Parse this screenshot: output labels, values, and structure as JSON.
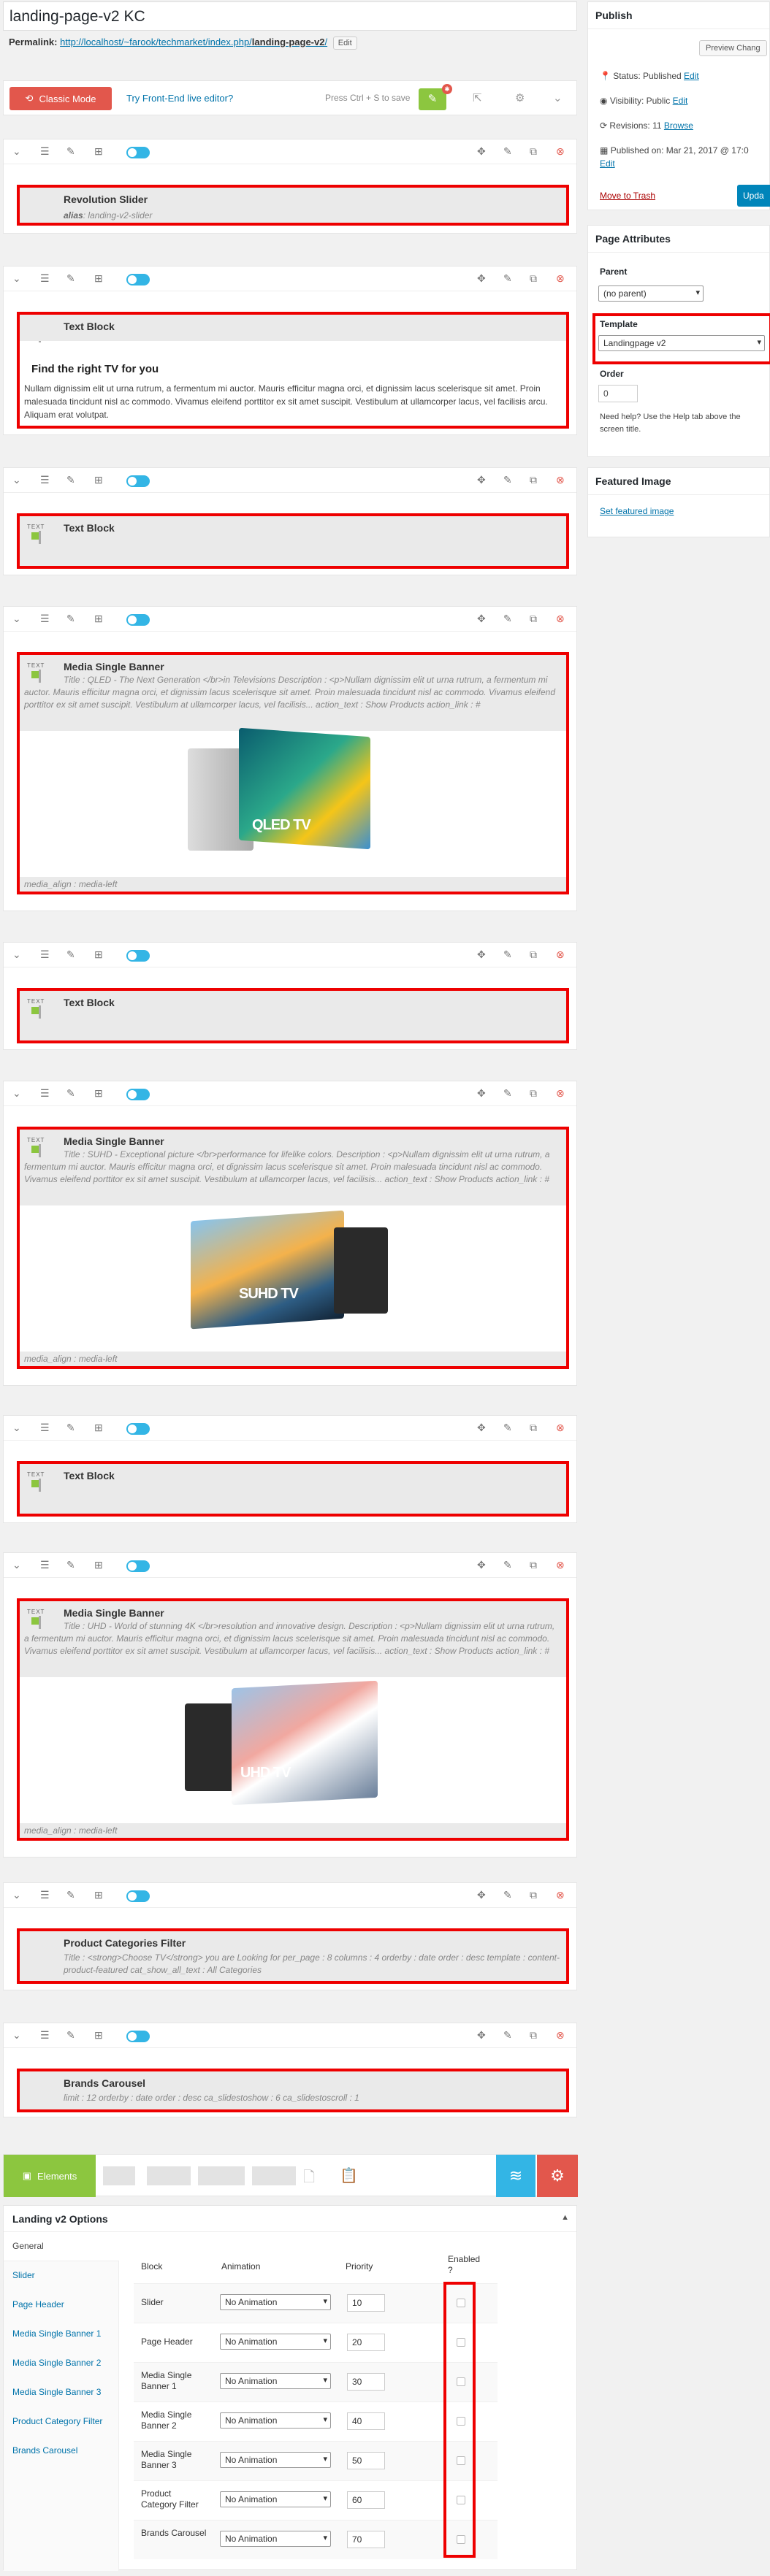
{
  "title": "landing-page-v2 KC",
  "permalink": {
    "label": "Permalink:",
    "url_base": "http://localhost/~farook/techmarket/index.php/",
    "slug": "landing-page-v2",
    "url_end": "/",
    "edit": "Edit"
  },
  "kc": {
    "classic": "Classic Mode",
    "try": "Try Front-End live editor?",
    "press": "Press Ctrl + S to save"
  },
  "rows": [
    {
      "title": "Revolution Slider",
      "sub_k": "alias",
      "sub_v": ": landing-v2-slider"
    },
    {
      "title": "Text Block",
      "heading": "Find the right TV for you",
      "para": "Nullam dignissim elit ut urna rutrum, a fermentum mi auctor. Mauris efficitur magna orci, et dignissim lacus scelerisque sit amet. Proin malesuada tincidunt nisl ac commodo. Vivamus eleifend porttitor ex sit amet suscipit. Vestibulum at ullamcorper lacus, vel facilisis arcu. Aliquam erat volutpat."
    },
    {
      "title": "Text Block"
    },
    {
      "title": "Media Single Banner",
      "desc": "Title : QLED - The Next Generation </br>in Televisions Description : <p>Nullam dignissim elit ut urna rutrum, a fermentum mi auctor. Mauris efficitur magna orci, et dignissim lacus scelerisque sit amet. Proin malesuada tincidunt nisl ac commodo. Vivamus eleifend porttitor ex sit amet suscipit. Vestibulum at ullamcorper lacus, vel facilisis... action_text : Show Products action_link : #",
      "media": "media_align : media-left",
      "tv": "QLED TV"
    },
    {
      "title": "Text Block"
    },
    {
      "title": "Media Single Banner",
      "desc": "Title : SUHD - Exceptional picture </br>performance for lifelike colors. Description : <p>Nullam dignissim elit ut urna rutrum, a fermentum mi auctor. Mauris efficitur magna orci, et dignissim lacus scelerisque sit amet. Proin malesuada tincidunt nisl ac commodo. Vivamus eleifend porttitor ex sit amet suscipit. Vestibulum at ullamcorper lacus, vel facilisis... action_text : Show Products action_link : #",
      "media": "media_align : media-left",
      "tv": "SUHD TV"
    },
    {
      "title": "Text Block"
    },
    {
      "title": "Media Single Banner",
      "desc": "Title : UHD - World of stunning 4K </br>resolution and innovative design. Description : <p>Nullam dignissim elit ut urna rutrum, a fermentum mi auctor. Mauris efficitur magna orci, et dignissim lacus scelerisque sit amet. Proin malesuada tincidunt nisl ac commodo. Vivamus eleifend porttitor ex sit amet suscipit. Vestibulum at ullamcorper lacus, vel facilisis... action_text : Show Products action_link : #",
      "media": "media_align : media-left",
      "tv": "UHD TV"
    },
    {
      "title": "Product Categories Filter",
      "desc": "Title : <strong>Choose TV</strong> you are Looking for per_page : 8 columns : 4 orderby : date order : desc template : content-product-featured cat_show_all_text : All Categories"
    },
    {
      "title": "Brands Carousel",
      "desc": "limit : 12 orderby : date order : desc ca_slidestoshow : 6 ca_slidestoscroll : 1"
    }
  ],
  "publish": {
    "title": "Publish",
    "preview": "Preview Chang",
    "status": "Status: Published",
    "visibility": "Visibility: Public",
    "revisions": "Revisions: 11",
    "browse": "Browse",
    "published": "Published on: Mar 21, 2017 @ 17:0",
    "edit": "Edit",
    "trash": "Move to Trash",
    "update": "Upda"
  },
  "attributes": {
    "title": "Page Attributes",
    "parent_label": "Parent",
    "parent_value": "(no parent)",
    "template_label": "Template",
    "template_value": "Landingpage v2",
    "order_label": "Order",
    "order_value": "0",
    "help": "Need help? Use the Help tab above the screen title."
  },
  "featured": {
    "title": "Featured Image",
    "link": "Set featured image"
  },
  "bottom": {
    "elements": "Elements"
  },
  "options": {
    "title": "Landing v2 Options",
    "nav": [
      "General",
      "Slider",
      "Page Header",
      "Media Single Banner 1",
      "Media Single Banner 2",
      "Media Single Banner 3",
      "Product Category Filter",
      "Brands Carousel"
    ],
    "headers": [
      "Block",
      "Animation",
      "Priority",
      "Enabled ?"
    ],
    "rows": [
      {
        "block": "Slider",
        "anim": "No Animation",
        "priority": "10"
      },
      {
        "block": "Page Header",
        "anim": "No Animation",
        "priority": "20"
      },
      {
        "block": "Media Single Banner 1",
        "anim": "No Animation",
        "priority": "30"
      },
      {
        "block": "Media Single Banner 2",
        "anim": "No Animation",
        "priority": "40"
      },
      {
        "block": "Media Single Banner 3",
        "anim": "No Animation",
        "priority": "50"
      },
      {
        "block": "Product Category Filter",
        "anim": "No Animation",
        "priority": "60"
      },
      {
        "block": "Brands Carousel",
        "anim": "No Animation",
        "priority": "70"
      }
    ]
  }
}
